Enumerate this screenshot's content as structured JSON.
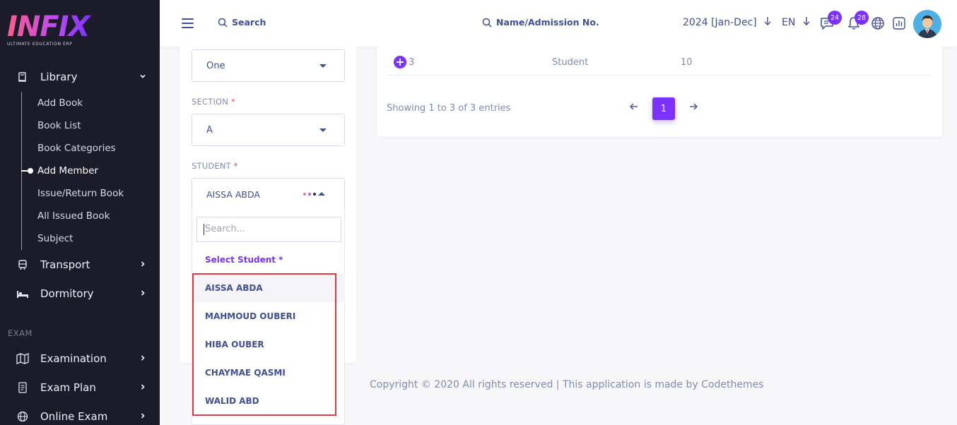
{
  "sidebar": {
    "logo_text": "INFIX",
    "logo_sub": "ULTIMATE EDUCATION ERP",
    "library_label": "Library",
    "sub_items": [
      "Add Book",
      "Book List",
      "Book Categories",
      "Add Member",
      "Issue/Return Book",
      "All Issued Book",
      "Subject"
    ],
    "active_sub": "Add Member",
    "transport_label": "Transport",
    "dormitory_label": "Dormitory",
    "section_exam": "EXAM",
    "examination_label": "Examination",
    "exam_plan_label": "Exam Plan",
    "online_exam_label": "Online Exam"
  },
  "topbar": {
    "search_placeholder": "Search",
    "search_admission": "Name/Admission No.",
    "year": "2024 [Jan-Dec]",
    "lang": "EN",
    "messages_badge": "24",
    "notifications_badge": "28"
  },
  "form": {
    "class_value": "One",
    "section_label": "SECTION",
    "section_value": "A",
    "student_label": "STUDENT",
    "required_mark": "*",
    "student_value": "AISSA ABDA",
    "search_placeholder": "Search...",
    "options": [
      "Select Student *",
      "AISSA ABDA",
      "MAHMOUD OUBERI",
      "HIBA OUBER",
      "CHAYMAE QASMI",
      "WALID ABD"
    ]
  },
  "table": {
    "row_id": "3",
    "row_role": "Student",
    "row_value": "10",
    "showing": "Showing 1 to 3 of 3 entries",
    "page": "1"
  },
  "footer": {
    "text": "Copyright © 2020 All rights reserved | This application is made by Codethemes"
  },
  "colors": {
    "accent": "#7c32ff",
    "text_primary": "#415094",
    "sidebar_bg": "#1b1b2a",
    "highlight_border": "#e0393e"
  }
}
